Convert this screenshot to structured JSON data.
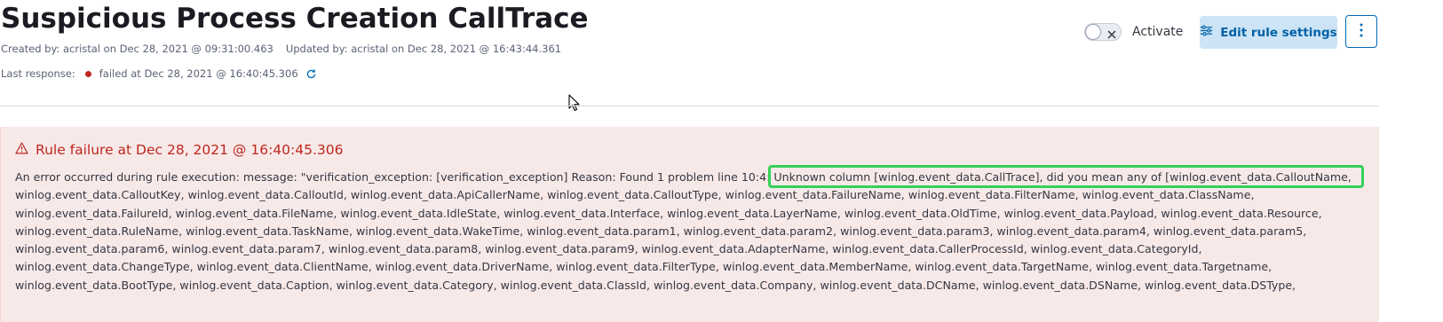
{
  "rule": {
    "title": "Suspicious Process Creation CallTrace",
    "created": "Created by: acristal on Dec 28, 2021 @ 09:31:00.463",
    "updated": "Updated by: acristal on Dec 28, 2021 @ 16:43:44.361",
    "last_response_label": "Last response:",
    "last_response_status": "failed at Dec 28, 2021 @ 16:40:45.306"
  },
  "actions": {
    "activate_label": "Activate",
    "activate_on": false,
    "edit_label": "Edit rule settings"
  },
  "failure": {
    "title": "Rule failure at Dec 28, 2021 @ 16:40:45.306",
    "lines": [
      "An error occurred during rule execution: message: \"verification_exception: [verification_exception] Reason: Found 1 problem line 10:4: Unknown column [winlog.event_data.CallTrace], did you mean any of [winlog.event_data.CalloutName,",
      "winlog.event_data.CalloutKey, winlog.event_data.CalloutId, winlog.event_data.ApiCallerName, winlog.event_data.CalloutType, winlog.event_data.FailureName, winlog.event_data.FilterName, winlog.event_data.ClassName,",
      "winlog.event_data.FailureId, winlog.event_data.FileName, winlog.event_data.IdleState, winlog.event_data.Interface, winlog.event_data.LayerName, winlog.event_data.OldTime, winlog.event_data.Payload, winlog.event_data.Resource,",
      "winlog.event_data.RuleName, winlog.event_data.TaskName, winlog.event_data.WakeTime, winlog.event_data.param1, winlog.event_data.param2, winlog.event_data.param3, winlog.event_data.param4, winlog.event_data.param5,",
      "winlog.event_data.param6, winlog.event_data.param7, winlog.event_data.param8, winlog.event_data.param9, winlog.event_data.AdapterName, winlog.event_data.CallerProcessId, winlog.event_data.CategoryId,",
      "winlog.event_data.ChangeType, winlog.event_data.ClientName, winlog.event_data.DriverName, winlog.event_data.FilterType, winlog.event_data.MemberName, winlog.event_data.TargetName, winlog.event_data.Targetname,",
      "winlog.event_data.BootType, winlog.event_data.Caption, winlog.event_data.Category, winlog.event_data.ClassId, winlog.event_data.Company, winlog.event_data.DCName, winlog.event_data.DSName, winlog.event_data.DSType,"
    ]
  },
  "icons": {
    "status": "status-dot",
    "refresh": "refresh-icon",
    "toggle_off": "close-icon",
    "edit": "sliders-icon",
    "more": "vertical-ellipsis-icon",
    "warning": "warning-icon",
    "cursor": "mouse-pointer-icon"
  },
  "colors": {
    "danger": "#bd271e",
    "primary": "#0061a6",
    "primary_bg": "#cce4f5",
    "callout_bg": "#f8e9e9",
    "highlight": "#35d05a"
  }
}
